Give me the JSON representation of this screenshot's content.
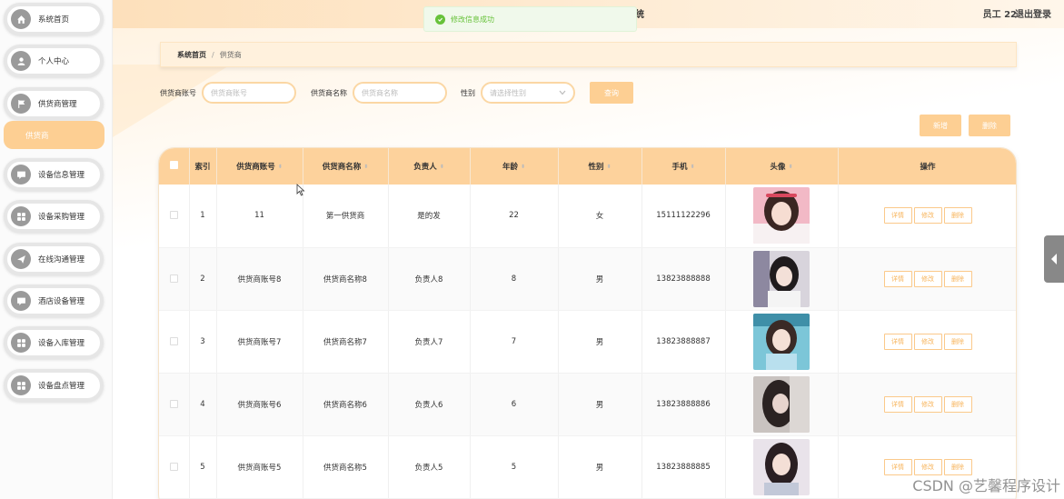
{
  "header": {
    "title": "统",
    "user": "员工 22",
    "logout": "退出登录"
  },
  "toast": {
    "message": "修改信息成功"
  },
  "sidebar": {
    "items": [
      {
        "label": "系统首页",
        "icon": "home-icon"
      },
      {
        "label": "个人中心",
        "icon": "user-icon"
      },
      {
        "label": "供货商管理",
        "icon": "flag-icon"
      },
      {
        "label": "设备信息管理",
        "icon": "chat-icon"
      },
      {
        "label": "设备采购管理",
        "icon": "grid-icon"
      },
      {
        "label": "在线沟通管理",
        "icon": "send-icon"
      },
      {
        "label": "酒店设备管理",
        "icon": "chat-icon"
      },
      {
        "label": "设备入库管理",
        "icon": "grid-icon"
      },
      {
        "label": "设备盘点管理",
        "icon": "grid-icon"
      }
    ],
    "sub_item": "供货商"
  },
  "breadcrumb": {
    "home": "系统首页",
    "separator": "/",
    "current": "供货商"
  },
  "search": {
    "account_label": "供货商账号",
    "account_placeholder": "供货商账号",
    "name_label": "供货商名称",
    "name_placeholder": "供货商名称",
    "gender_label": "性别",
    "gender_placeholder": "请选择性别",
    "query_button": "查询"
  },
  "actions": {
    "add": "新增",
    "delete": "删除"
  },
  "table": {
    "columns": [
      "索引",
      "供货商账号",
      "供货商名称",
      "负责人",
      "年龄",
      "性别",
      "手机",
      "头像",
      "操作"
    ],
    "rows": [
      {
        "index": "1",
        "account": "11",
        "name": "第一供货商",
        "manager": "是的发",
        "age": "22",
        "gender": "女",
        "phone": "15111122296"
      },
      {
        "index": "2",
        "account": "供货商账号8",
        "name": "供货商名称8",
        "manager": "负责人8",
        "age": "8",
        "gender": "男",
        "phone": "13823888888"
      },
      {
        "index": "3",
        "account": "供货商账号7",
        "name": "供货商名称7",
        "manager": "负责人7",
        "age": "7",
        "gender": "男",
        "phone": "13823888887"
      },
      {
        "index": "4",
        "account": "供货商账号6",
        "name": "供货商名称6",
        "manager": "负责人6",
        "age": "6",
        "gender": "男",
        "phone": "13823888886"
      },
      {
        "index": "5",
        "account": "供货商账号5",
        "name": "供货商名称5",
        "manager": "负责人5",
        "age": "5",
        "gender": "男",
        "phone": "13823888885"
      }
    ],
    "row_actions": {
      "detail": "详情",
      "edit": "修改",
      "delete": "删除"
    }
  },
  "watermark": "CSDN @艺馨程序设计"
}
